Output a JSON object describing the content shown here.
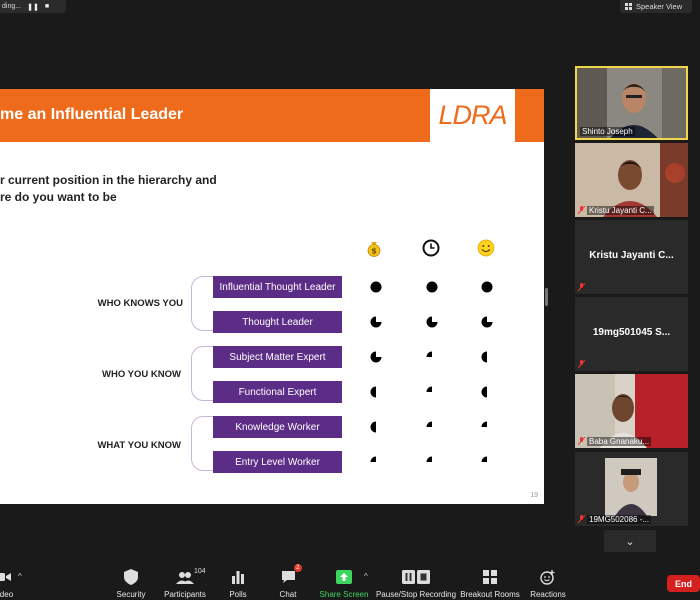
{
  "recording": {
    "label": "ding...",
    "pause_icon": "pause-icon",
    "stop_icon": "stop-icon"
  },
  "view": {
    "speaker_view_label": "Speaker View"
  },
  "slide": {
    "title": "me an Influential Leader",
    "logo": "LDRA",
    "question_line1": "r current position in the hierarchy and",
    "question_line2": "re do you want to be",
    "column_icons": [
      "money-bag-icon",
      "clock-icon",
      "smiley-icon"
    ],
    "groups": [
      {
        "label": "WHO KNOWS YOU",
        "roles": [
          {
            "name": "Influential Thought Leader",
            "levels": [
              1,
              1,
              1
            ]
          },
          {
            "name": "Thought Leader",
            "levels": [
              0.75,
              0.75,
              0.75
            ]
          }
        ]
      },
      {
        "label": "WHO YOU KNOW",
        "roles": [
          {
            "name": "Subject Matter Expert",
            "levels": [
              0.75,
              0.25,
              0.5
            ]
          },
          {
            "name": "Functional Expert",
            "levels": [
              0.5,
              0.25,
              0.5
            ]
          }
        ]
      },
      {
        "label": "WHAT YOU KNOW",
        "roles": [
          {
            "name": "Knowledge Worker",
            "levels": [
              0.5,
              0.25,
              0.25
            ]
          },
          {
            "name": "Entry Level Worker",
            "levels": [
              0.25,
              0.25,
              0.25
            ]
          }
        ]
      }
    ],
    "page_number": "19"
  },
  "participants_panel": [
    {
      "name": "Shinto Joseph",
      "type": "video",
      "active": true
    },
    {
      "name": "Kristu Jayanti C...",
      "type": "video",
      "muted": true
    },
    {
      "name": "Kristu Jayanti C...",
      "type": "name-only",
      "muted": true
    },
    {
      "name": "19mg501045 S...",
      "type": "name-only",
      "muted": true
    },
    {
      "name": "Baba Gnanaku...",
      "type": "video",
      "muted": true
    },
    {
      "name": "19MG502086 -...",
      "type": "video",
      "muted": true
    }
  ],
  "toolbar": {
    "video_label": "Video",
    "security_label": "Security",
    "participants_label": "Participants",
    "participants_count": "104",
    "polls_label": "Polls",
    "chat_label": "Chat",
    "chat_badge": "2",
    "share_label": "Share Screen",
    "recording_label": "Pause/Stop Recording",
    "breakout_label": "Breakout Rooms",
    "reactions_label": "Reactions",
    "end_label": "End"
  },
  "colors": {
    "slide_orange": "#ed6b1a",
    "role_purple": "#5b2d86",
    "share_green": "#3dd65f",
    "end_red": "#d4201f",
    "active_border": "#f0d84a"
  }
}
